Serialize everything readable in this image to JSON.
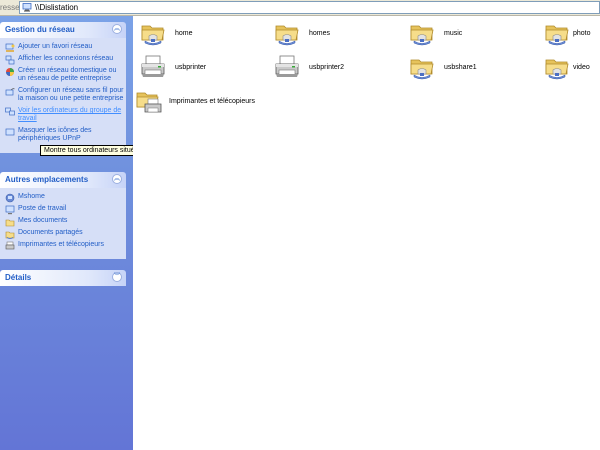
{
  "address": {
    "label": "resse",
    "path": "\\\\Dislistation"
  },
  "network_tasks": {
    "title": "Gestion du réseau",
    "items": [
      "Ajouter un favori réseau",
      "Afficher les connexions réseau",
      "Créer un réseau domestique ou un réseau de petite entreprise",
      "Configurer un réseau sans fil pour la maison ou une petite entreprise",
      "Voir les ordinateurs du groupe de travail",
      "Masquer les icônes des périphériques UPnP"
    ]
  },
  "tooltip": "Montre tous ordinateurs situés dans le même groupe de travail que votre ordinateur.",
  "other_places": {
    "title": "Autres emplacements",
    "items": [
      "Mshome",
      "Poste de travail",
      "Mes documents",
      "Documents partagés",
      "Imprimantes et télécopieurs"
    ]
  },
  "details": {
    "title": "Détails"
  },
  "shares": [
    {
      "name": "home",
      "type": "folder-share"
    },
    {
      "name": "homes",
      "type": "folder-share"
    },
    {
      "name": "music",
      "type": "folder-share"
    },
    {
      "name": "photo",
      "type": "folder-share"
    },
    {
      "name": "usbprinter",
      "type": "printer"
    },
    {
      "name": "usbprinter2",
      "type": "printer"
    },
    {
      "name": "usbshare1",
      "type": "folder-share"
    },
    {
      "name": "video",
      "type": "folder-share"
    },
    {
      "name": "Imprimantes et télécopieurs",
      "type": "printers-folder"
    }
  ]
}
